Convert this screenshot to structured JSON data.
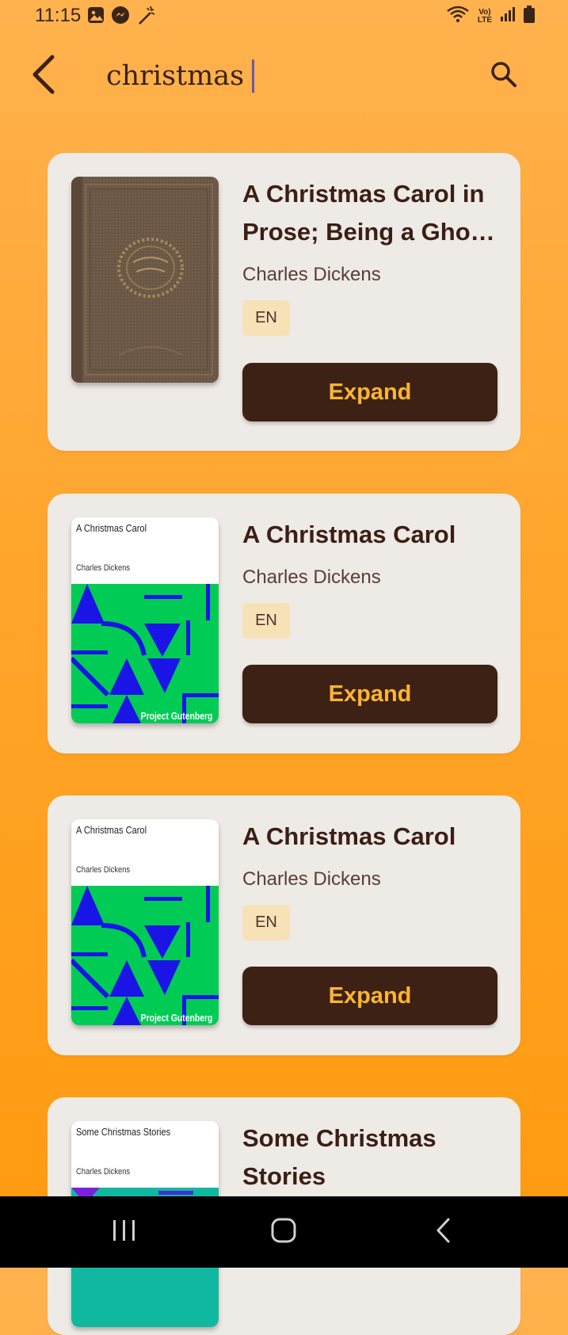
{
  "status": {
    "time": "11:15",
    "left_icons": [
      "gallery-icon",
      "messenger-icon",
      "magic-wand-icon"
    ],
    "right_icons": [
      "wifi-icon",
      "volte-icon",
      "signal-icon",
      "battery-icon"
    ],
    "volte_line1": "Vo)",
    "volte_line2": "LTE"
  },
  "search": {
    "query": "christmas"
  },
  "colors": {
    "background_top": "#ffb24e",
    "background_bottom": "#ff9a0e",
    "card": "#eeeae6",
    "button": "#3e2115",
    "button_text": "#fbb62e",
    "badge": "#f7e2b8"
  },
  "results": [
    {
      "title": "A Christmas Carol in Prose; Being a Gho…",
      "author": "Charles Dickens",
      "language": "EN",
      "action": "Expand",
      "cover": "antique-book-cover"
    },
    {
      "title": "A Christmas Carol",
      "author": "Charles Dickens",
      "language": "EN",
      "action": "Expand",
      "cover": "project-gutenberg-cover",
      "cover_title": "A Christmas Carol",
      "cover_author": "Charles Dickens",
      "cover_label": "Project Gutenberg"
    },
    {
      "title": "A Christmas Carol",
      "author": "Charles Dickens",
      "language": "EN",
      "action": "Expand",
      "cover": "project-gutenberg-cover",
      "cover_title": "A Christmas Carol",
      "cover_author": "Charles Dickens",
      "cover_label": "Project Gutenberg"
    },
    {
      "title": "Some Christmas Stories",
      "author": "",
      "language": "",
      "action": "",
      "cover": "project-gutenberg-cover",
      "cover_title": "Some Christmas Stories",
      "cover_author": "Charles Dickens",
      "cover_label": ""
    }
  ],
  "navigation": {
    "buttons": [
      "recent-apps-icon",
      "home-icon",
      "back-icon"
    ]
  }
}
